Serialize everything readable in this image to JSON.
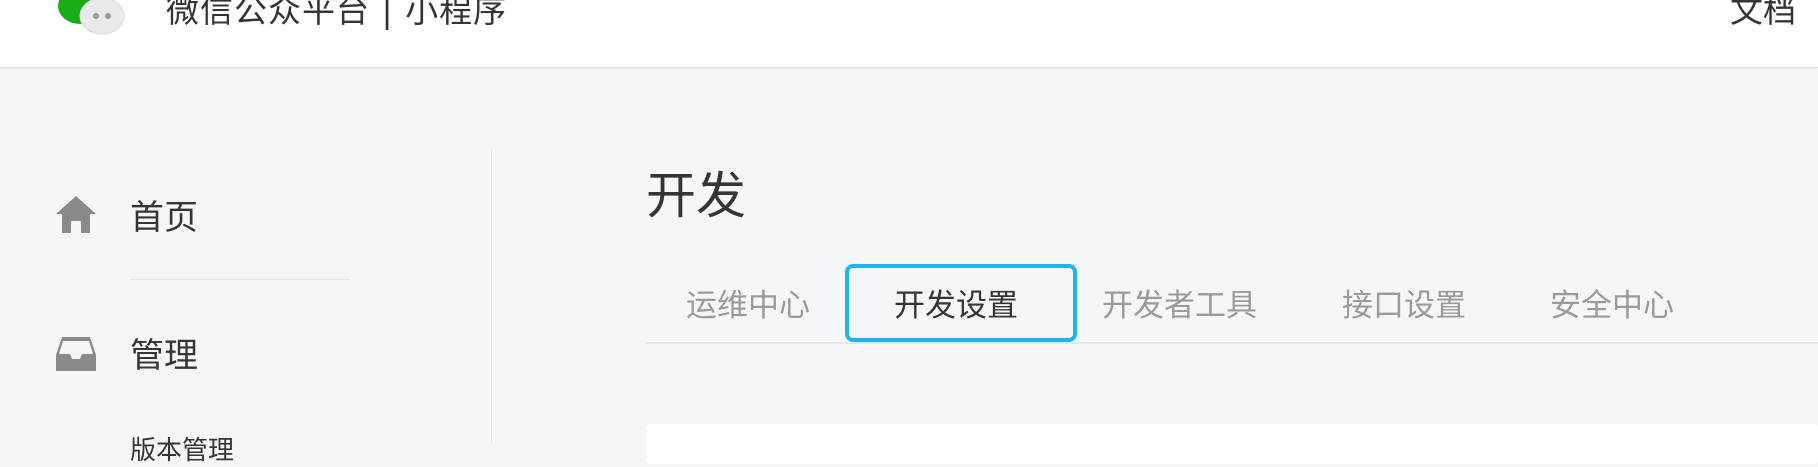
{
  "header": {
    "brand": "微信公众平台 | 小程序",
    "docs_link": "文档"
  },
  "sidebar": {
    "items": [
      {
        "label": "首页",
        "icon": "home-icon"
      },
      {
        "label": "管理",
        "icon": "inbox-icon"
      }
    ],
    "sub_items": [
      {
        "label": "版本管理"
      }
    ]
  },
  "main": {
    "title": "开发",
    "tabs": [
      {
        "label": "运维中心",
        "active": false
      },
      {
        "label": "开发设置",
        "active": true
      },
      {
        "label": "开发者工具",
        "active": false
      },
      {
        "label": "接口设置",
        "active": false
      },
      {
        "label": "安全中心",
        "active": false
      }
    ]
  },
  "colors": {
    "page_bg": "#f5f6f8",
    "highlight": "#1cb8ec",
    "logo_green": "#1aad19",
    "icon_gray": "#8a8a8a",
    "inactive_tab": "#9a9a9a"
  }
}
